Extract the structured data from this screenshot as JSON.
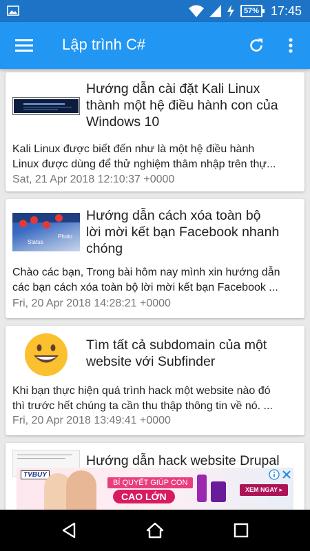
{
  "status_bar": {
    "battery": "57%",
    "time": "17:45"
  },
  "app_bar": {
    "title": "Lập trình C#"
  },
  "articles": [
    {
      "title_lines": [
        "Hướng dẫn cài đặt Kali Linux",
        "thành một hệ điều hành con của",
        "Windows 10"
      ],
      "summary_lines": [
        "Kali Linux được biết đến như là một hệ điều hành",
        "Linux được dùng để thử nghiệm thâm nhập trên thự..."
      ],
      "date": "Sat, 21 Apr 2018 12:10:37 +0000"
    },
    {
      "title_lines": [
        "Hướng dẫn cách xóa toàn bộ",
        "lời mời kết bạn Facebook nhanh",
        "chóng"
      ],
      "summary_lines": [
        "Chào các bạn, Trong bài hôm nay mình xin hướng dẫn",
        "các bạn cách xóa toàn bộ lời mời kết bạn Facebook ..."
      ],
      "date": "Fri, 20 Apr 2018 14:28:21 +0000",
      "thumb_text": {
        "status": "Status",
        "photo": "Photo"
      }
    },
    {
      "title_lines": [
        "Tìm tất cả subdomain của một",
        "website với Subfinder"
      ],
      "summary_lines": [
        "Khi bạn thực hiện quá trình hack một website nào đó",
        "thì trước hết chúng ta cần thu thập thông tin về nó. ..."
      ],
      "date": "Fri, 20 Apr 2018 13:49:41 +0000"
    },
    {
      "title_lines": [
        "Hướng dẫn hack website Drupal"
      ]
    }
  ],
  "ad": {
    "brand": "TVBUY",
    "line1": "BÍ QUYẾT GIÚP CON",
    "line2": "CAO LỚN",
    "cta": "XEM NGAY ▸"
  },
  "colors": {
    "status_bar": "#1d74c6",
    "app_bar": "#2196f3",
    "background": "#e9e9e9"
  }
}
